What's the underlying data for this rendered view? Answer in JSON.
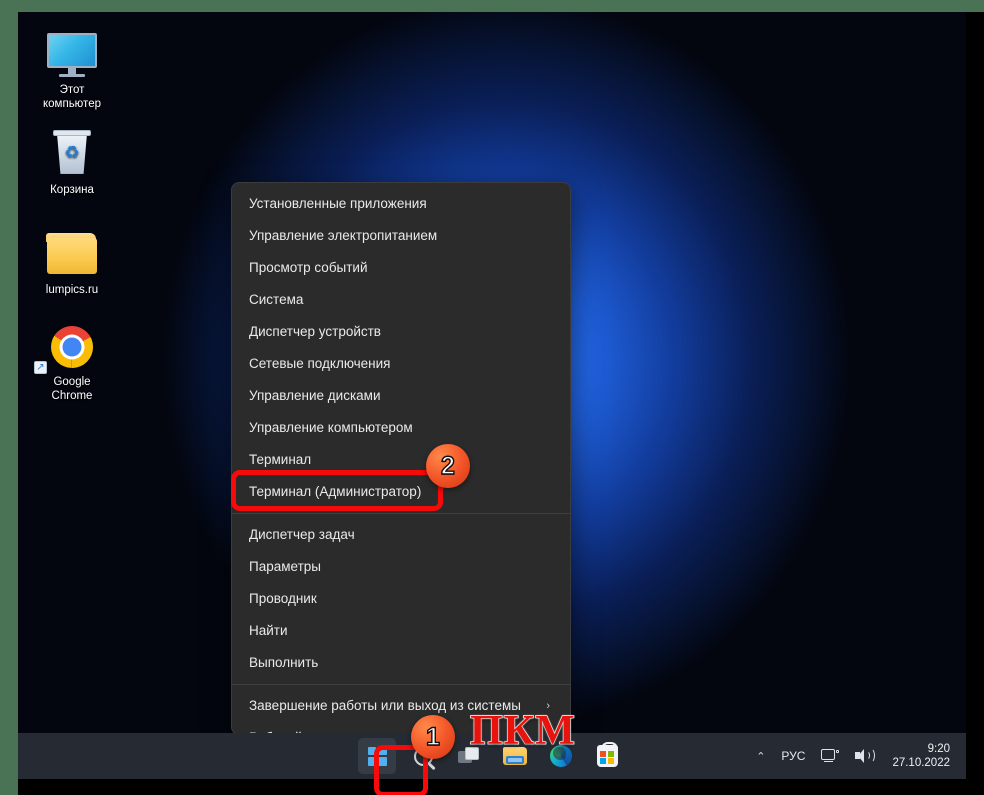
{
  "desktop": {
    "icons": [
      {
        "name": "this-pc",
        "label": "Этот\nкомпьютер",
        "icon": "monitor-icon"
      },
      {
        "name": "recycle-bin",
        "label": "Корзина",
        "icon": "recycle-bin-icon"
      },
      {
        "name": "lumpics-folder",
        "label": "lumpics.ru",
        "icon": "folder-icon"
      },
      {
        "name": "google-chrome",
        "label": "Google\nChrome",
        "icon": "chrome-icon"
      }
    ],
    "icon_labels": {
      "this_pc_line1": "Этот",
      "this_pc_line2": "компьютер",
      "recycle_bin": "Корзина",
      "folder": "lumpics.ru",
      "chrome_line1": "Google",
      "chrome_line2": "Chrome"
    }
  },
  "context_menu": {
    "name": "win-x-power-user-menu",
    "items": [
      {
        "label": "Установленные приложения",
        "submenu": false
      },
      {
        "label": "Управление электропитанием",
        "submenu": false
      },
      {
        "label": "Просмотр событий",
        "submenu": false
      },
      {
        "label": "Система",
        "submenu": false
      },
      {
        "label": "Диспетчер устройств",
        "submenu": false
      },
      {
        "label": "Сетевые подключения",
        "submenu": false
      },
      {
        "label": "Управление дисками",
        "submenu": false
      },
      {
        "label": "Управление компьютером",
        "submenu": false
      },
      {
        "label": "Терминал",
        "submenu": false
      },
      {
        "label": "Терминал (Администратор)",
        "submenu": false,
        "highlighted": true
      },
      {
        "label": "Диспетчер задач",
        "submenu": false
      },
      {
        "label": "Параметры",
        "submenu": false
      },
      {
        "label": "Проводник",
        "submenu": false
      },
      {
        "label": "Найти",
        "submenu": false
      },
      {
        "label": "Выполнить",
        "submenu": false
      },
      {
        "label": "Завершение работы или выход из системы",
        "submenu": true,
        "chevron": "›"
      },
      {
        "label": "Рабочий стол",
        "submenu": false
      }
    ]
  },
  "taskbar": {
    "buttons": [
      {
        "name": "start-button",
        "icon": "windows-logo-icon",
        "active": true
      },
      {
        "name": "search-button",
        "icon": "search-icon",
        "active": false
      },
      {
        "name": "task-view-button",
        "icon": "task-view-icon",
        "active": false
      },
      {
        "name": "file-explorer-button",
        "icon": "folder-icon",
        "active": false
      },
      {
        "name": "edge-button",
        "icon": "edge-icon",
        "active": false
      },
      {
        "name": "store-button",
        "icon": "microsoft-store-icon",
        "active": false
      }
    ],
    "tray": {
      "overflow_caret": "⌃",
      "language": "РУС",
      "network_icon": "network-icon",
      "volume_icon": "volume-icon"
    },
    "clock": {
      "time": "9:20",
      "date": "27.10.2022"
    }
  },
  "annotations": {
    "badge_1": "1",
    "badge_2": "2",
    "pkm_label": "ПКМ",
    "highlight_color": "#f60a0a",
    "badge_color": "#f4582a",
    "pkm_color": "#e8130d"
  }
}
